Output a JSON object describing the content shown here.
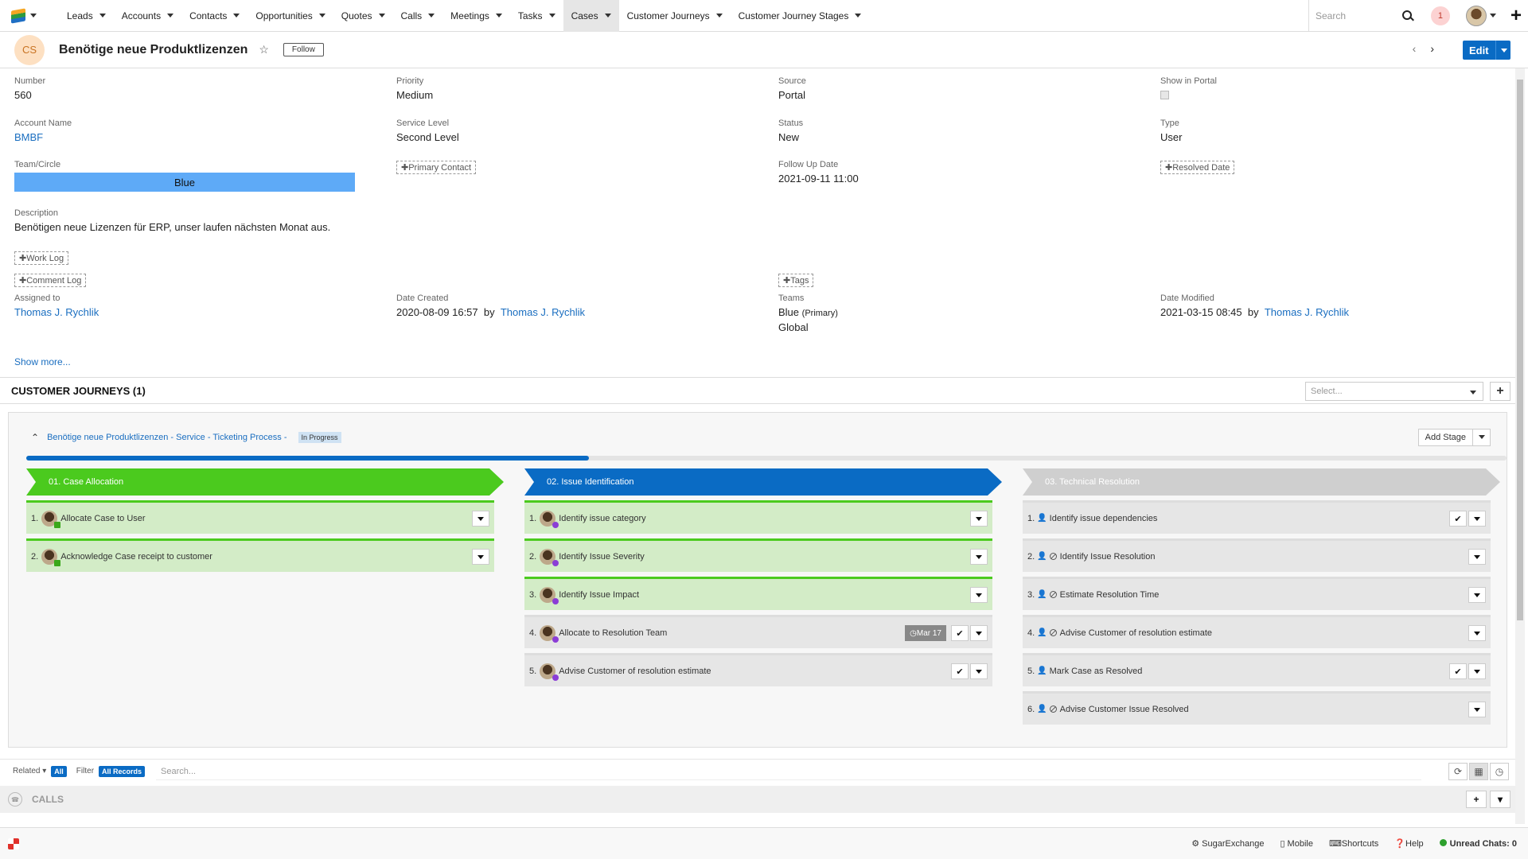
{
  "nav": {
    "items": [
      "Leads",
      "Accounts",
      "Contacts",
      "Opportunities",
      "Quotes",
      "Calls",
      "Meetings",
      "Tasks",
      "Cases",
      "Customer Journeys",
      "Customer Journey Stages"
    ],
    "active": "Cases",
    "search_placeholder": "Search",
    "notification_count": "1"
  },
  "record": {
    "initials": "CS",
    "title": "Benötige neue Produktlizenzen",
    "follow_label": "Follow",
    "edit_label": "Edit"
  },
  "fields": {
    "number": {
      "label": "Number",
      "value": "560"
    },
    "priority": {
      "label": "Priority",
      "value": "Medium"
    },
    "source": {
      "label": "Source",
      "value": "Portal"
    },
    "show_portal": {
      "label": "Show in Portal"
    },
    "account": {
      "label": "Account Name",
      "value": "BMBF"
    },
    "service_level": {
      "label": "Service Level",
      "value": "Second Level"
    },
    "status": {
      "label": "Status",
      "value": "New"
    },
    "type": {
      "label": "Type",
      "value": "User"
    },
    "team_circle": {
      "label": "Team/Circle",
      "value": "Blue"
    },
    "primary_contact": "Primary Contact",
    "follow_up": {
      "label": "Follow Up Date",
      "value": "2021-09-11 11:00"
    },
    "resolved_date": "Resolved Date",
    "description": {
      "label": "Description",
      "value": "Benötigen neue Lizenzen für ERP, unser laufen nächsten Monat aus."
    },
    "work_log": "Work Log",
    "comment_log": "Comment Log",
    "tags": "Tags",
    "assigned": {
      "label": "Assigned to",
      "value": "Thomas J. Rychlik"
    },
    "created": {
      "label": "Date Created",
      "date": "2020-08-09 16:57",
      "by": "by",
      "user": "Thomas J. Rychlik"
    },
    "teams": {
      "label": "Teams",
      "primary": "Blue",
      "primary_suffix": "(Primary)",
      "second": "Global"
    },
    "modified": {
      "label": "Date Modified",
      "date": "2021-03-15 08:45",
      "by": "by",
      "user": "Thomas J. Rychlik"
    },
    "show_more": "Show more..."
  },
  "journeys": {
    "header": "CUSTOMER JOURNEYS (1)",
    "select_placeholder": "Select...",
    "journey_title": "Benötige neue Produktlizenzen - Service - Ticketing Process -",
    "status_badge": "In Progress",
    "add_stage": "Add Stage",
    "progress_percent": 38,
    "stages": [
      {
        "name": "01. Case Allocation",
        "color": "#4bca1e",
        "tasks": [
          {
            "n": "1.",
            "label": "Allocate Case to User",
            "done": true
          },
          {
            "n": "2.",
            "label": "Acknowledge Case receipt to customer",
            "done": true
          }
        ]
      },
      {
        "name": "02. Issue Identification",
        "color": "#0a6bc4",
        "tasks": [
          {
            "n": "1.",
            "label": "Identify issue category",
            "done": true
          },
          {
            "n": "2.",
            "label": "Identify Issue Severity",
            "done": true
          },
          {
            "n": "3.",
            "label": "Identify Issue Impact",
            "done": true
          },
          {
            "n": "4.",
            "label": "Allocate to Resolution Team",
            "done": false,
            "date": "Mar 17",
            "check": true
          },
          {
            "n": "5.",
            "label": "Advise Customer of resolution estimate",
            "done": false,
            "check": true
          }
        ]
      },
      {
        "name": "03. Technical Resolution",
        "color": "#cfcfcf",
        "tasks": [
          {
            "n": "1.",
            "label": "Identify issue dependencies",
            "check": true
          },
          {
            "n": "2.",
            "label": "Identify Issue Resolution",
            "ban": true
          },
          {
            "n": "3.",
            "label": "Estimate Resolution Time",
            "ban": true
          },
          {
            "n": "4.",
            "label": "Advise Customer of resolution estimate",
            "ban": true
          },
          {
            "n": "5.",
            "label": "Mark Case as Resolved",
            "check": true
          },
          {
            "n": "6.",
            "label": "Advise Customer Issue Resolved",
            "ban": true
          }
        ]
      }
    ]
  },
  "filter": {
    "related": "Related",
    "all": "All",
    "filter": "Filter",
    "all_records": "All Records",
    "search_placeholder": "Search..."
  },
  "calls": {
    "label": "CALLS"
  },
  "footer": {
    "sugarexchange": "SugarExchange",
    "mobile": "Mobile",
    "shortcuts": "Shortcuts",
    "help": "Help",
    "chats": "Unread Chats: 0"
  }
}
